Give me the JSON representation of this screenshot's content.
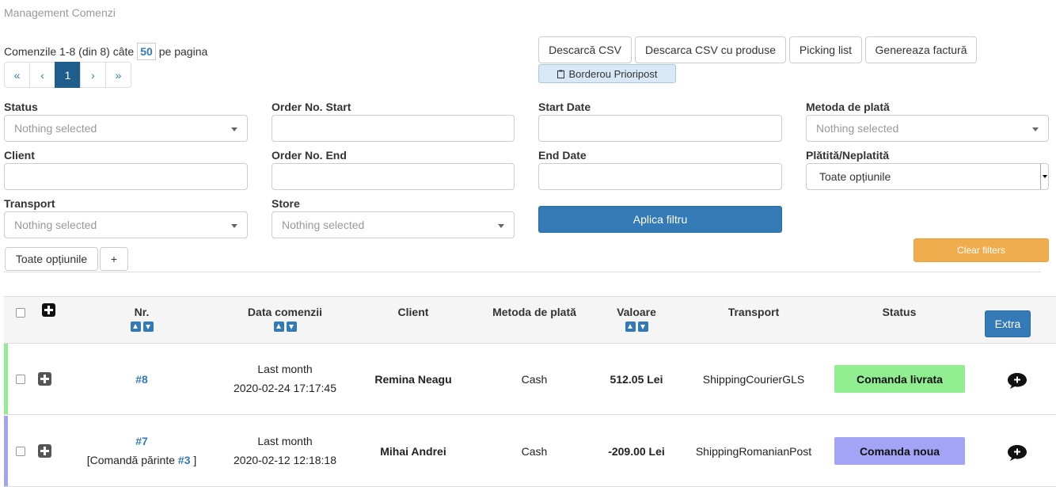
{
  "header": {
    "title": "Management Comenzi"
  },
  "pagination": {
    "summary_prefix": "Comenzile 1-8 (din 8) câte",
    "per_page": "50",
    "summary_suffix": "pe pagina",
    "first": "«",
    "prev": "‹",
    "current": "1",
    "next": "›",
    "last": "»"
  },
  "actions": {
    "download_csv": "Descarcă CSV",
    "download_csv_products": "Descarca CSV cu produse",
    "picking_list": "Picking list",
    "generate_invoice": "Genereaza factură",
    "borderou": "Borderou Prioripost"
  },
  "filters": {
    "status_label": "Status",
    "status_value": "Nothing selected",
    "order_start_label": "Order No. Start",
    "start_date_label": "Start Date",
    "payment_method_label": "Metoda de plată",
    "payment_method_value": "Nothing selected",
    "client_label": "Client",
    "order_end_label": "Order No. End",
    "end_date_label": "End Date",
    "paid_label": "Plătită/Neplatită",
    "paid_value": "Toate opțiunile",
    "transport_label": "Transport",
    "transport_value": "Nothing selected",
    "store_label": "Store",
    "store_value": "Nothing selected",
    "apply": "Aplica filtru",
    "clear": "Clear filters",
    "all_options": "Toate opțiunile",
    "add": "+"
  },
  "table": {
    "headers": {
      "nr": "Nr.",
      "date": "Data comenzii",
      "client": "Client",
      "payment": "Metoda de plată",
      "value": "Valoare",
      "transport": "Transport",
      "status": "Status",
      "extra": "Extra"
    },
    "rows": [
      {
        "nr": "#8",
        "parent_prefix": "",
        "parent_link": "",
        "parent_suffix": "",
        "date_relative": "Last month",
        "date": "2020-02-24 17:17:45",
        "client": "Remina Neagu",
        "payment": "Cash",
        "value": "512.05 Lei",
        "transport": "ShippingCourierGLS",
        "status": "Comanda livrata",
        "status_color": "#90ee90",
        "bar_color": "#90ee90"
      },
      {
        "nr": "#7",
        "parent_prefix": "[Comandă părinte",
        "parent_link": "#3",
        "parent_suffix": "]",
        "date_relative": "Last month",
        "date": "2020-02-12 12:18:18",
        "client": "Mihai Andrei",
        "payment": "Cash",
        "value": "-209.00 Lei",
        "transport": "ShippingRomanianPost",
        "status": "Comanda noua",
        "status_color": "#a4a4f6",
        "bar_color": "#a4a4f6"
      }
    ]
  },
  "icons": {
    "comment": "comment-icon",
    "expand": "plus-square-icon",
    "clipboard": "clipboard-icon"
  }
}
